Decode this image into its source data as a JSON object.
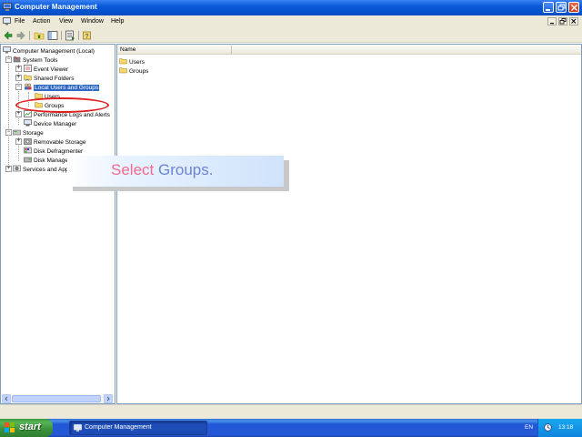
{
  "window": {
    "title": "Computer Management"
  },
  "menu": {
    "items": [
      "File",
      "Action",
      "View",
      "Window",
      "Help"
    ]
  },
  "toolbar": {
    "icons": [
      "back-icon",
      "forward-icon",
      "up-folder-icon",
      "show-hide-tree-icon",
      "export-list-icon",
      "help-icon"
    ]
  },
  "tree": {
    "root": "Computer Management (Local)",
    "system_tools": "System Tools",
    "event_viewer": "Event Viewer",
    "shared_folders": "Shared Folders",
    "local_users_groups": "Local Users and Groups",
    "users": "Users",
    "groups": "Groups",
    "perf_logs": "Performance Logs and Alerts",
    "device_manager": "Device Manager",
    "storage": "Storage",
    "removable_storage": "Removable Storage",
    "disk_defrag": "Disk Defragmenter",
    "disk_management": "Disk Management",
    "services_apps": "Services and Applications"
  },
  "list": {
    "column_name": "Name",
    "items": [
      "Users",
      "Groups"
    ]
  },
  "overlay": {
    "verb": "Select",
    "object": "Groups."
  },
  "taskbar": {
    "start_label": "start",
    "task_label": "Computer Management",
    "language": "EN",
    "clock": "13:18"
  },
  "colors": {
    "title_bar": "#0553d0",
    "selection": "#316ac5",
    "highlight_ellipse": "#e02020",
    "callout_verb": "#f26a8d",
    "callout_object": "#6d83d3"
  }
}
